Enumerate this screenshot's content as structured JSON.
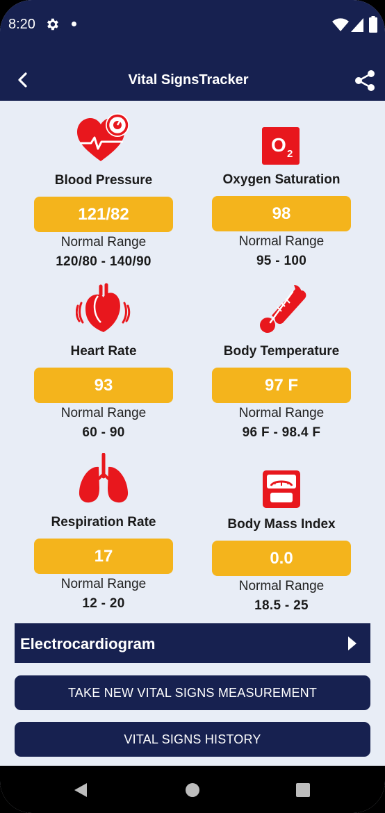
{
  "status_bar": {
    "time": "8:20"
  },
  "app_bar": {
    "title": "Vital SignsTracker"
  },
  "vitals": [
    {
      "label": "Blood Pressure",
      "value": "121/82",
      "range_title": "Normal Range",
      "range": "120/80 -  140/90"
    },
    {
      "label": "Oxygen Saturation",
      "value": "98",
      "range_title": "Normal Range",
      "range": "95 - 100"
    },
    {
      "label": "Heart Rate",
      "value": "93",
      "range_title": "Normal Range",
      "range": "60 - 90"
    },
    {
      "label": "Body Temperature",
      "value": "97 F",
      "range_title": "Normal Range",
      "range": "96 F - 98.4 F"
    },
    {
      "label": "Respiration Rate",
      "value": "17",
      "range_title": "Normal Range",
      "range": "12 - 20"
    },
    {
      "label": "Body Mass Index",
      "value": "0.0",
      "range_title": "Normal Range",
      "range": "18.5 - 25"
    }
  ],
  "icons": {
    "o2_text": "O",
    "o2_sub": "2"
  },
  "ecg": {
    "label": "Electrocardiogram"
  },
  "buttons": {
    "take_new": "TAKE NEW VITAL SIGNS MEASUREMENT",
    "history": "VITAL SIGNS HISTORY"
  },
  "colors": {
    "navy": "#172150",
    "accent": "#f4b41c",
    "icon_red": "#e8171d",
    "background": "#e8edf6"
  }
}
